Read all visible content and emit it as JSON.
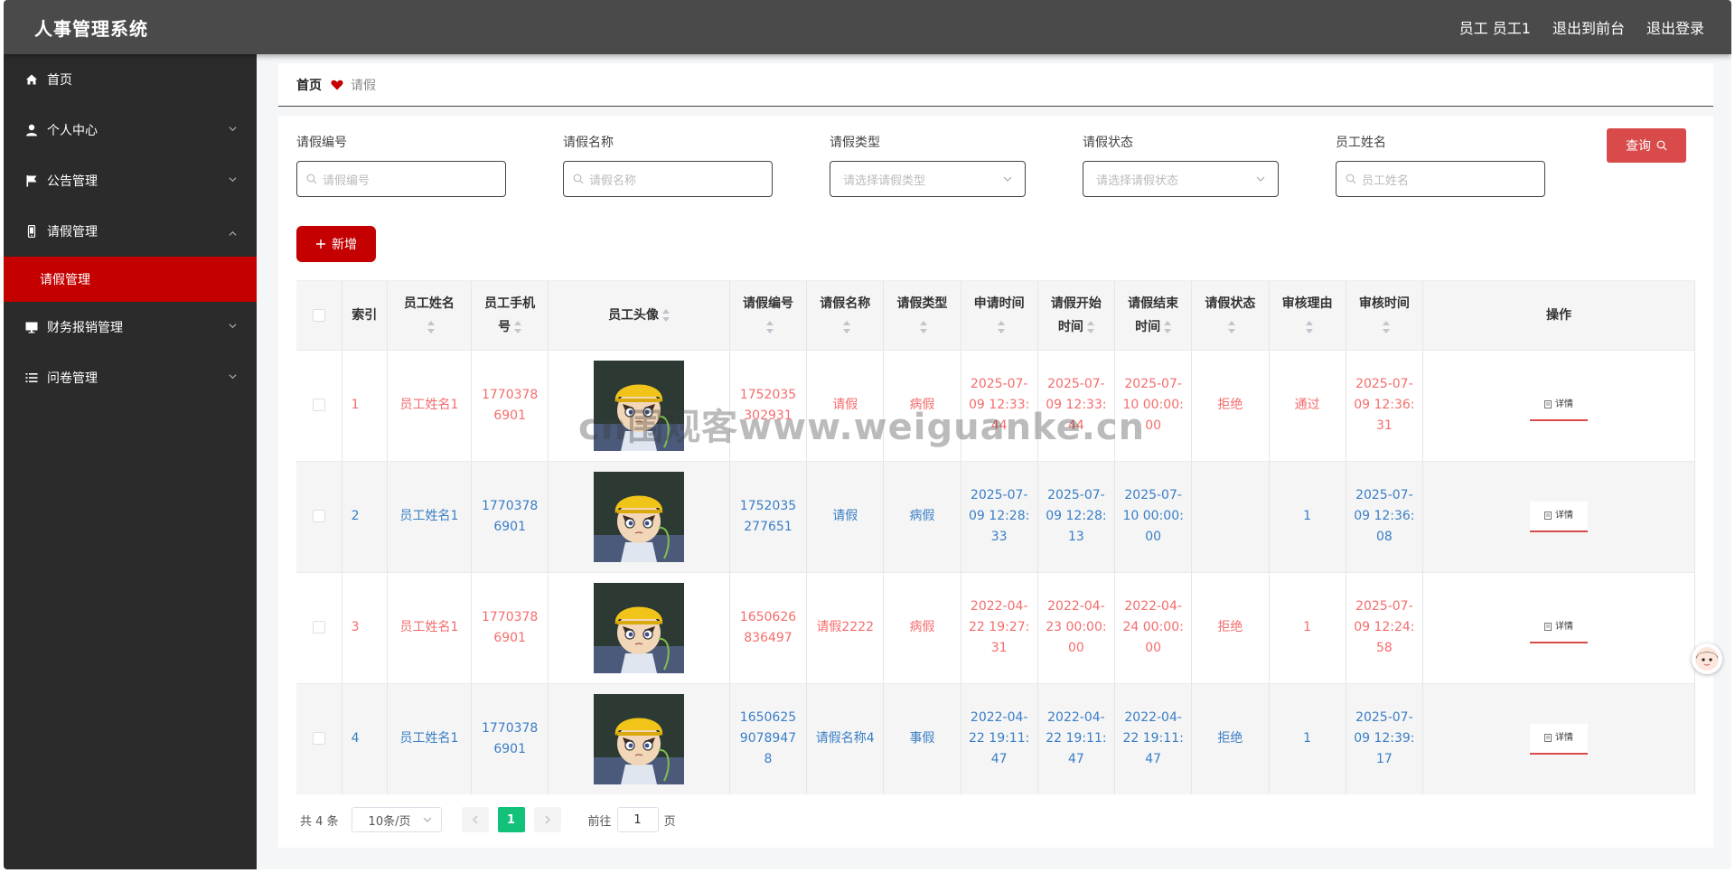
{
  "header": {
    "title": "人事管理系统",
    "user_label": "员工 员工1",
    "to_front_label": "退出到前台",
    "logout_label": "退出登录"
  },
  "sidebar": {
    "items": [
      {
        "label": "首页",
        "icon": "home-icon"
      },
      {
        "label": "个人中心",
        "icon": "user-icon"
      },
      {
        "label": "公告管理",
        "icon": "flag-icon"
      },
      {
        "label": "请假管理",
        "icon": "phone-icon"
      },
      {
        "label": "财务报销管理",
        "icon": "monitor-icon"
      },
      {
        "label": "问卷管理",
        "icon": "list-icon"
      }
    ],
    "active_sub": "请假管理"
  },
  "breadcrumb": {
    "home": "首页",
    "current": "请假"
  },
  "search": {
    "fields": [
      {
        "label": "请假编号",
        "placeholder": "请假编号",
        "kind": "input"
      },
      {
        "label": "请假名称",
        "placeholder": "请假名称",
        "kind": "input"
      },
      {
        "label": "请假类型",
        "placeholder": "请选择请假类型",
        "kind": "select"
      },
      {
        "label": "请假状态",
        "placeholder": "请选择请假状态",
        "kind": "select"
      },
      {
        "label": "员工姓名",
        "placeholder": "员工姓名",
        "kind": "input"
      }
    ],
    "query_label": "查询",
    "add_label": "新增"
  },
  "table": {
    "headers": {
      "index": "索引",
      "name": "员工姓名",
      "phone": "员工手机号",
      "avatar": "员工头像",
      "code": "请假编号",
      "leave_name": "请假名称",
      "type": "请假类型",
      "apply_time": "申请时间",
      "start_time": "请假开始时间",
      "end_time": "请假结束时间",
      "status": "请假状态",
      "reason": "审核理由",
      "review_time": "审核时间",
      "action": "操作"
    },
    "detail_label": "详情",
    "rows": [
      {
        "index": "1",
        "name": "员工姓名1",
        "phone": "17703786901",
        "code": "1752035302931",
        "leave_name": "请假",
        "type": "病假",
        "apply_time": "2025-07-09 12:33:44",
        "start_time": "2025-07-09 12:33:44",
        "end_time": "2025-07-10 00:00:00",
        "status": "拒绝",
        "reason": "通过",
        "review_time": "2025-07-09 12:36:31",
        "tone": "red"
      },
      {
        "index": "2",
        "name": "员工姓名1",
        "phone": "17703786901",
        "code": "1752035277651",
        "leave_name": "请假",
        "type": "病假",
        "apply_time": "2025-07-09 12:28:33",
        "start_time": "2025-07-09 12:28:13",
        "end_time": "2025-07-10 00:00:00",
        "status": "",
        "reason": "1",
        "review_time": "2025-07-09 12:36:08",
        "tone": "blue"
      },
      {
        "index": "3",
        "name": "员工姓名1",
        "phone": "17703786901",
        "code": "1650626836497",
        "leave_name": "请假2222",
        "type": "病假",
        "apply_time": "2022-04-22 19:27:31",
        "start_time": "2022-04-23 00:00:00",
        "end_time": "2022-04-24 00:00:00",
        "status": "拒绝",
        "reason": "1",
        "review_time": "2025-07-09 12:24:58",
        "tone": "red"
      },
      {
        "index": "4",
        "name": "员工姓名1",
        "phone": "17703786901",
        "code": "16506259078947 8",
        "leave_name": "请假名称4",
        "type": "事假",
        "apply_time": "2022-04-22 19:11:47",
        "start_time": "2022-04-22 19:11:47",
        "end_time": "2022-04-22 19:11:47",
        "status": "拒绝",
        "reason": "1",
        "review_time": "2025-07-09 12:39:17",
        "tone": "blue"
      }
    ]
  },
  "pagination": {
    "total": "共 4 条",
    "page_size": "10条/页",
    "current_page": "1",
    "goto_prefix": "前往",
    "goto_value": "1",
    "goto_suffix": "页"
  },
  "watermark": "cn围观客www.weiguanke.cn",
  "colors": {
    "header_bg": "#4a4a4a",
    "sidebar_bg": "#2b2b2b",
    "accent_red": "#c40000",
    "query_red": "#d94a4a",
    "text_red": "#f56c6c",
    "text_blue": "#3a7ec6",
    "page_green": "#13c27a"
  }
}
